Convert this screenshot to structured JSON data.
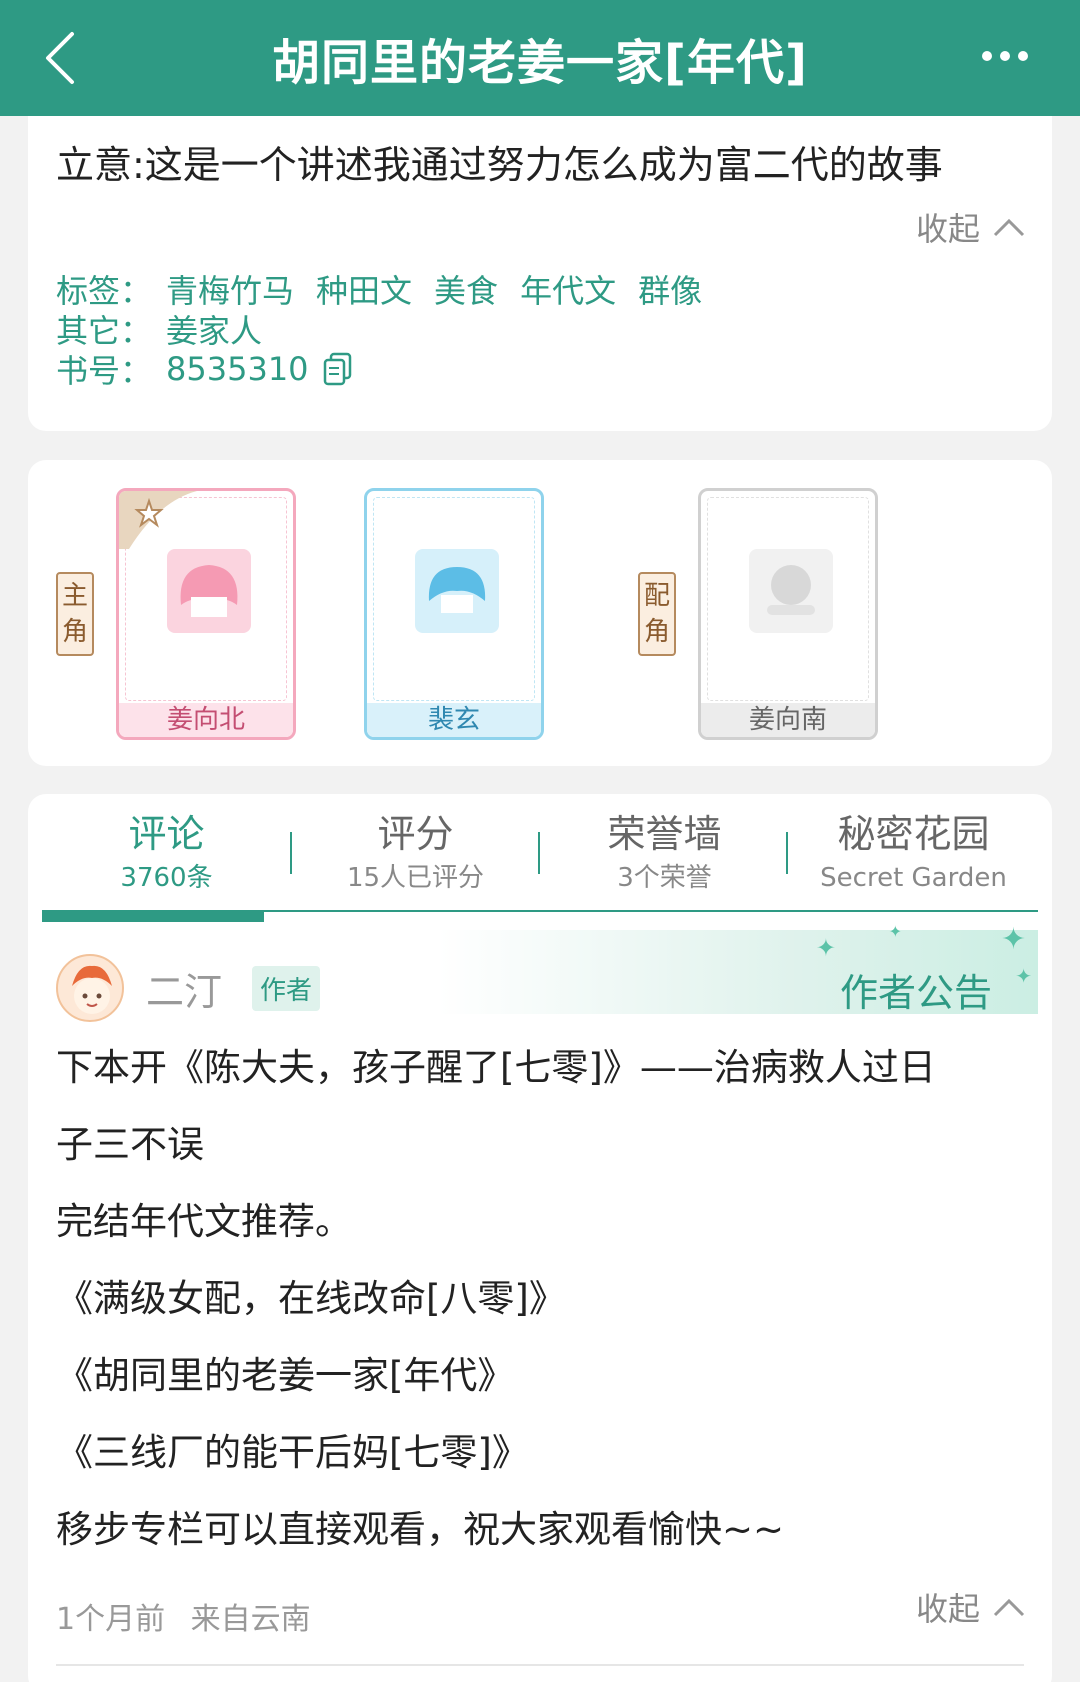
{
  "header": {
    "title": "胡同里的老姜一家[年代]"
  },
  "intro": {
    "text": "立意:这是一个讲述我通过努力怎么成为富二代的故事",
    "collapse_label": "收起",
    "tags_key": "标签：",
    "tags": [
      "青梅竹马",
      "种田文",
      "美食",
      "年代文",
      "群像"
    ],
    "other_key": "其它：",
    "other_value": "姜家人",
    "book_no_key": "书号：",
    "book_no": "8535310"
  },
  "characters": {
    "main_label": [
      "主",
      "角"
    ],
    "support_label": [
      "配",
      "角"
    ],
    "items": [
      {
        "name": "姜向北",
        "theme": "pink"
      },
      {
        "name": "裴玄",
        "theme": "blue"
      },
      {
        "name": "姜向南",
        "theme": "grey"
      }
    ]
  },
  "tabs": [
    {
      "title": "评论",
      "sub": "3760条"
    },
    {
      "title": "评分",
      "sub": "15人已评分"
    },
    {
      "title": "荣誉墙",
      "sub": "3个荣誉"
    },
    {
      "title": "秘密花园",
      "sub": "Secret Garden"
    }
  ],
  "notice": {
    "author_name": "二汀",
    "author_badge": "作者",
    "banner_title": "作者公告",
    "lines": [
      "下本开《陈大夫，孩子醒了[七零]》——治病救人过日",
      "子三不误",
      "完结年代文推荐。",
      "《满级女配，在线改命[八零]》",
      "《胡同里的老姜一家[年代》",
      "《三线厂的能干后妈[七零]》",
      "移步专栏可以直接观看，祝大家观看愉快~~"
    ],
    "time": "1个月前",
    "location": "来自云南",
    "collapse_label": "收起"
  },
  "colors": {
    "accent": "#2e9a84"
  }
}
